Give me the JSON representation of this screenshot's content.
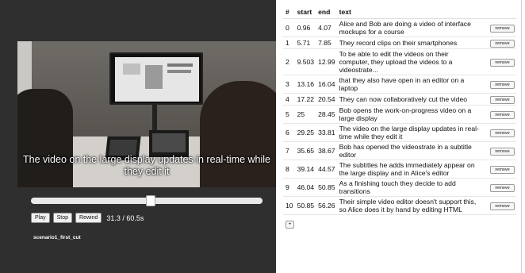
{
  "player": {
    "subtitle": "The video on the large display updates in real-time while they edit it",
    "progress": 0.517,
    "buttons": {
      "play": "Play",
      "stop": "Stop",
      "rewind": "Rewind"
    },
    "time_display": "31.3 / 60.5s",
    "cut_name": "scenario1_first_cut"
  },
  "table": {
    "headers": [
      "#",
      "start",
      "end",
      "text"
    ],
    "remove_label": "remove",
    "add_label": "+",
    "rows": [
      {
        "n": "0",
        "start": "0.96",
        "end": "4.07",
        "text": "Alice and Bob are doing a video of interface mockups for a course"
      },
      {
        "n": "1",
        "start": "5.71",
        "end": "7.85",
        "text": "They record clips on their smartphones"
      },
      {
        "n": "2",
        "start": "9.503",
        "end": "12.99",
        "text": "To be able to edit the videos on their computer, they upload the videos to a videostrate..."
      },
      {
        "n": "3",
        "start": "13.16",
        "end": "16.04",
        "text": "that they also have open in an editor on a laptop"
      },
      {
        "n": "4",
        "start": "17.22",
        "end": "20.54",
        "text": "They can now collaboratively cut the video"
      },
      {
        "n": "5",
        "start": "25",
        "end": "28.45",
        "text": "Bob opens the work-on-progress video on a large display"
      },
      {
        "n": "6",
        "start": "29.25",
        "end": "33.81",
        "text": "The video on the large display updates in real-time while they edit it"
      },
      {
        "n": "7",
        "start": "35.65",
        "end": "38.67",
        "text": "Bob has opened the videostrate in a subtitle editor"
      },
      {
        "n": "8",
        "start": "39.14",
        "end": "44.57",
        "text": "The subtitles he adds immediately appear on the large display and in Alice's editor"
      },
      {
        "n": "9",
        "start": "46.04",
        "end": "50.85",
        "text": "As a finishing touch they decide to add transitions"
      },
      {
        "n": "10",
        "start": "50.85",
        "end": "56.26",
        "text": "Their simple video editor doesn't support this, so Alice does it by hand by editing HTML"
      }
    ]
  }
}
